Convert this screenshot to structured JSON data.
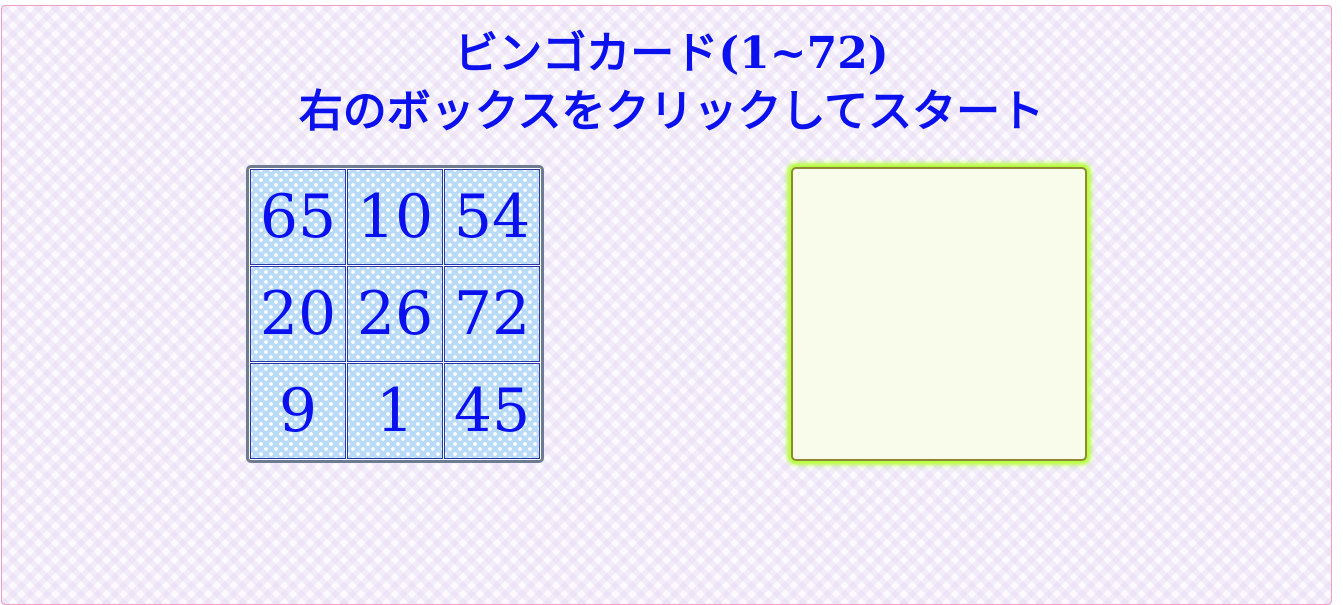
{
  "header": {
    "title_main": "ビンゴカード",
    "title_range": "(1~72)",
    "instruction": "右のボックスをクリックしてスタート"
  },
  "bingo_card": {
    "cells": [
      "65",
      "10",
      "54",
      "20",
      "26",
      "72",
      "9",
      "1",
      "45"
    ]
  },
  "start_box": {
    "text": ""
  },
  "colors": {
    "text": "#0a10ee",
    "frame_border": "#f29ec0",
    "cell_background": "#b9dbf8",
    "start_box_background": "#fafceb",
    "start_box_glow": "#b8ff3c"
  }
}
